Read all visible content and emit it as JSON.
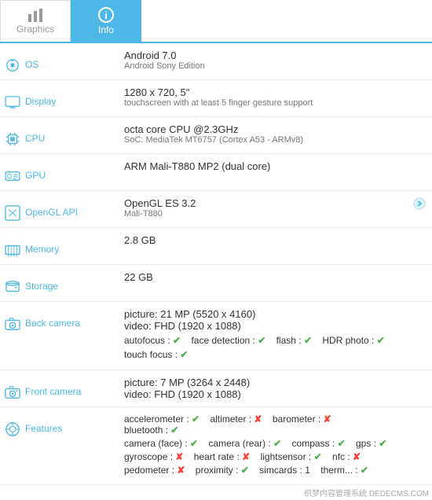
{
  "tabs": [
    {
      "id": "graphics",
      "label": "Graphics",
      "icon": "bar-chart",
      "active": false
    },
    {
      "id": "info",
      "label": "Info",
      "icon": "info",
      "active": true
    }
  ],
  "rows": [
    {
      "id": "os",
      "label": "OS",
      "icon": "android",
      "value_main": "Android 7.0",
      "value_sub": "Android Sony Edition",
      "has_chevron": false
    },
    {
      "id": "display",
      "label": "Display",
      "icon": "display",
      "value_main": "1280 x 720, 5\"",
      "value_sub": "touchscreen with at least 5 finger gesture support",
      "has_chevron": false
    },
    {
      "id": "cpu",
      "label": "CPU",
      "icon": "cpu",
      "value_main": "octa core CPU @2.3GHz",
      "value_sub": "SoC: MediaTek MT6757 (Cortex A53 - ARMv8)",
      "has_chevron": false
    },
    {
      "id": "gpu",
      "label": "GPU",
      "icon": "gpu",
      "value_main": "ARM Mali-T880 MP2 (dual core)",
      "value_sub": "",
      "has_chevron": false
    },
    {
      "id": "opengl",
      "label": "OpenGL API",
      "icon": "opengl",
      "value_main": "OpenGL ES 3.2",
      "value_sub": "Mali-T880",
      "has_chevron": true
    },
    {
      "id": "memory",
      "label": "Memory",
      "icon": "memory",
      "value_main": "2.8 GB",
      "value_sub": "",
      "has_chevron": false
    },
    {
      "id": "storage",
      "label": "Storage",
      "icon": "storage",
      "value_main": "22 GB",
      "value_sub": "",
      "has_chevron": false
    },
    {
      "id": "back_camera",
      "label": "Back camera",
      "icon": "camera",
      "value_type": "camera_back",
      "has_chevron": false
    },
    {
      "id": "front_camera",
      "label": "Front camera",
      "icon": "front-camera",
      "value_type": "camera_front",
      "has_chevron": false
    },
    {
      "id": "features",
      "label": "Features",
      "icon": "features",
      "value_type": "features",
      "has_chevron": false
    }
  ],
  "back_camera": {
    "picture": "picture: 21 MP (5520 x 4160)",
    "video": "video: FHD (1920 x 1088)",
    "features": [
      {
        "name": "autofocus",
        "check": true
      },
      {
        "name": "face detection",
        "check": true
      },
      {
        "name": "flash",
        "check": true
      },
      {
        "name": "HDR photo",
        "check": true
      }
    ],
    "extra": [
      {
        "name": "touch focus",
        "check": true
      }
    ]
  },
  "front_camera": {
    "picture": "picture: 7 MP (3264 x 2448)",
    "video": "video: FHD (1920 x 1088)"
  },
  "features": [
    {
      "name": "accelerometer",
      "check": true
    },
    {
      "name": "altimeter",
      "check": false
    },
    {
      "name": "barometer",
      "check": false
    },
    {
      "name": "bluetooth",
      "check": true
    },
    {
      "name": "camera (face)",
      "check": true
    },
    {
      "name": "camera (rear)",
      "check": true
    },
    {
      "name": "compass",
      "check": true
    },
    {
      "name": "gps",
      "check": true
    },
    {
      "name": "gyroscope",
      "check": false
    },
    {
      "name": "heart rate",
      "check": false
    },
    {
      "name": "lightsensor",
      "check": true
    },
    {
      "name": "nfc",
      "check": false
    },
    {
      "name": "pedometer",
      "check": false
    },
    {
      "name": "proximity",
      "check": true
    },
    {
      "name": "simcards",
      "value": "1"
    },
    {
      "name": "therm...",
      "check": true
    }
  ],
  "watermark": "织梦内容管理系统 DEDECMS.COM"
}
